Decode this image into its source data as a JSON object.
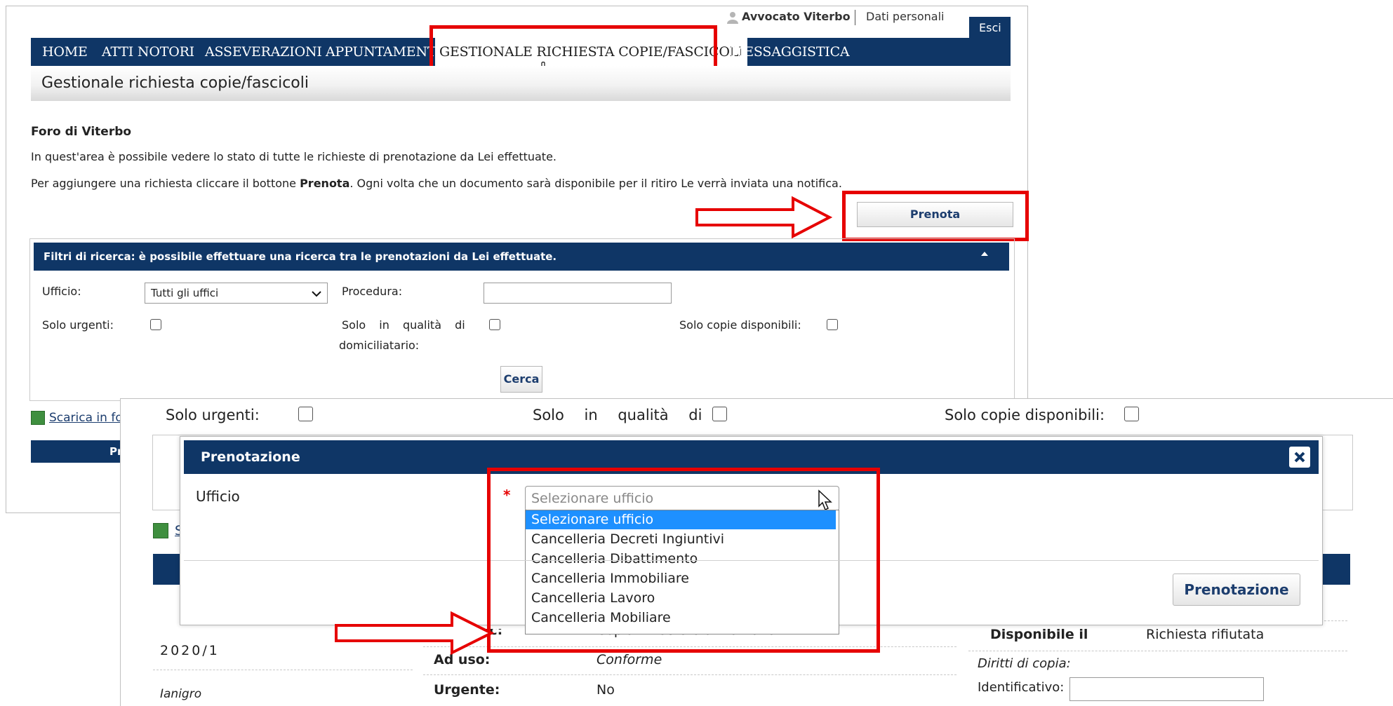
{
  "header": {
    "user_label": "Avvocato Viterbo",
    "personal_data_link": "Dati personali",
    "logout_button": "Esci"
  },
  "nav": {
    "items": [
      "HOME",
      "ATTI NOTORI",
      "ASSEVERAZIONI",
      "APPUNTAMENTI",
      "GESTIONALE RICHIESTA COPIE/FASCICOLI",
      "MESSAGGISTICA"
    ]
  },
  "page": {
    "title": "Gestionale richiesta copie/fascicoli",
    "foro": "Foro di Viterbo",
    "desc1": "In quest'area è possibile vedere lo stato di tutte le richieste di prenotazione da Lei effettuate.",
    "desc2_pre": "Per aggiungere una richiesta cliccare il bottone ",
    "desc2_bold": "Prenota",
    "desc2_post": ". Ogni volta che un documento sarà disponibile per il ritiro Le verrà inviata una notifica.",
    "prenota_button": "Prenota",
    "download_link": "Scarica in fo"
  },
  "filters": {
    "header": "Filtri di ricerca: è possibile effettuare una ricerca tra le prenotazioni da Lei effettuate.",
    "ufficio_label": "Ufficio:",
    "ufficio_value": "Tutti gli uffici",
    "procedura_label": "Procedura:",
    "solo_urgenti_label": "Solo urgenti:",
    "domiciliatario_label_1": "Solo in qualità di",
    "domiciliatario_label_2": "domiciliatario:",
    "copie_disponibili_label": "Solo copie disponibili:",
    "cerca_button": "Cerca",
    "table_header_fragment": "Pr"
  },
  "zoom": {
    "solo_urgenti_label": "Solo urgenti:",
    "domiciliatario_label": "Solo in qualità di",
    "copie_disponibili_label": "Solo copie disponibili:",
    "download_fragment": "S"
  },
  "modal": {
    "title": "Prenotazione",
    "ufficio_label": "Ufficio",
    "required_mark": "*",
    "select_placeholder": "Selezionare ufficio",
    "options": [
      "Selezionare ufficio",
      "Cancelleria Decreti Ingiuntivi",
      "Cancelleria Dibattimento",
      "Cancelleria Immobiliare",
      "Cancelleria Lavoro",
      "Cancelleria Mobiliare"
    ],
    "submit_button": "Prenotazione",
    "close_icon": "close-icon"
  },
  "record": {
    "number": "2020/1",
    "name": "Ianigro",
    "tipo_doc_label": "Tipo doc:",
    "tipo_doc_value": "Copia - Decreto anno 2020",
    "ad_uso_label": "Ad uso:",
    "ad_uso_value": "Conforme",
    "urgente_label": "Urgente:",
    "urgente_value": "No",
    "disponibile_label": "Disponibile il",
    "disponibile_value": "Richiesta rifiutata",
    "diritti_label": "Diritti di copia:",
    "identificativo_label": "Identificativo:"
  },
  "colors": {
    "navy": "#0f3666",
    "highlight_red": "#e60000",
    "dropdown_selected": "#1e90ff"
  }
}
